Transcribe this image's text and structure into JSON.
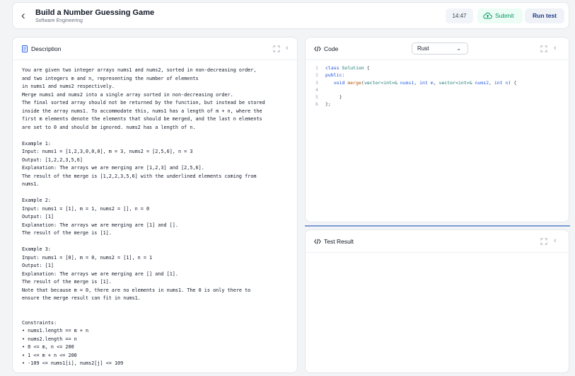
{
  "header": {
    "title": "Build a Number Guessing Game",
    "subtitle": "Software Engineering",
    "timer": "14:47",
    "submit_label": "Submit",
    "run_label": "Run test"
  },
  "description": {
    "title": "Description",
    "lines": [
      "You are given two integer arrays nums1 and nums2, sorted in non-decreasing order,",
      "and two integers m and n, representing the number of elements",
      "in nums1 and nums2 respectively.",
      "Merge nums1 and nums2 into a single array sorted in non-decreasing order.",
      "The final sorted array should not be returned by the function, but instead be stored",
      "inside the array nums1. To accommodate this, nums1 has a length of m + n, where the",
      "first m elements denote the elements that should be merged, and the last n elements",
      "are set to 0 and should be ignored. nums2 has a length of n.",
      "",
      "Example 1:",
      "Input: nums1 = [1,2,3,0,0,0], m = 3, nums2 = [2,5,6], n = 3",
      "Output: [1,2,2,3,5,6]",
      "Explanation: The arrays we are merging are [1,2,3] and [2,5,6].",
      "The result of the merge is [1,2,2,3,5,6] with the underlined elements coming from",
      "nums1.",
      "",
      "Example 2:",
      "Input: nums1 = [1], m = 1, nums2 = [], n = 0",
      "Output: [1]",
      "Explanation: The arrays we are merging are [1] and [].",
      "The result of the merge is [1].",
      "",
      "Example 3:",
      "Input: nums1 = [0], m = 0, nums2 = [1], n = 1",
      "Output: [1]",
      "Explanation: The arrays we are merging are [] and [1].",
      "The result of the merge is [1].",
      "Note that because m = 0, there are no elements in nums1. The 0 is only there to",
      "ensure the merge result can fit in nums1.",
      "",
      "",
      "Constraints:",
      "• nums1.length == m + n",
      "• nums2.length == n",
      "• 0 <= m, n <= 200",
      "• 1 <= m + n <= 200",
      "• -109 <= nums1[i], nums2[j] <= 109"
    ]
  },
  "code": {
    "title": "Code",
    "language": "Rust",
    "line_numbers": [
      "1",
      "2",
      "3",
      "4",
      "5",
      "6"
    ],
    "tokens": {
      "class": "class",
      "solution": "Solution",
      "open_brace": " {",
      "public": "public:",
      "void": "void",
      "merge": "merge",
      "open_paren": "(",
      "vector1": "vector<int>&",
      "nums1": "nums1",
      "comma1": ", ",
      "int1": "int",
      "m": "m",
      "comma2": ", ",
      "vector2": "vector<int>&",
      "nums2": "nums2",
      "comma3": ", ",
      "int2": "int",
      "n": "n",
      "close_paren_brace": ") {",
      "close_brace": "}",
      "close_class": "};"
    }
  },
  "test": {
    "title": "Test Result"
  },
  "colors": {
    "submit": "#059669",
    "run": "#1e3a8a",
    "splitter": "#7c9cd6"
  }
}
